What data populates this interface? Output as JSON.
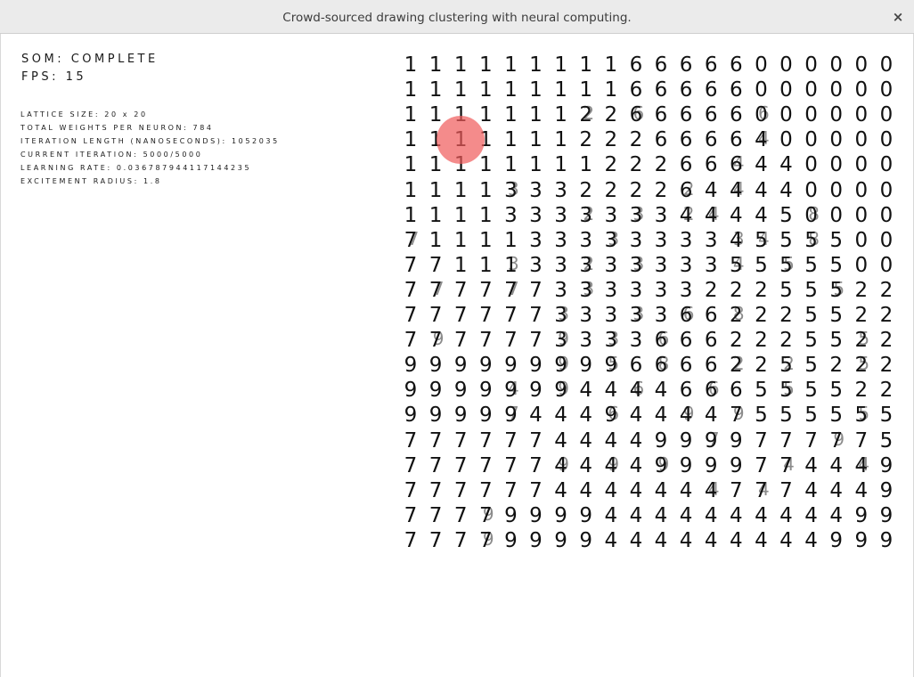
{
  "window": {
    "title": "Crowd-sourced drawing clustering with neural computing.",
    "close_symbol": "×"
  },
  "status": {
    "som": "SOM: COMPLETE",
    "fps": "FPS: 15"
  },
  "stats": [
    "LATTICE SIZE: 20 x 20",
    "TOTAL WEIGHTS PER NEURON: 784",
    "ITERATION LENGTH (NANOSECONDS): 1052035",
    "CURRENT ITERATION: 5000/5000",
    "LEARNING RATE: 0.036787944117144235",
    "EXCITEMENT RADIUS: 1.8"
  ],
  "lattice": {
    "rows": [
      "11111111166666000000",
      "11111111166666000000",
      "11111112266666000000",
      "11111112226666400000",
      "11111111222666440000",
      "11113332222644440000",
      "11113333333444450000",
      "71111333333334555500",
      "77111333333335555500",
      "77777733333322255522",
      "77777733333662225522",
      "77777733336662225522",
      "99999999966662255222",
      "99999994444666555522",
      "99999444944447555555",
      "77777744449999777775",
      "77777744449999774449",
      "77777744444447774449",
      "77779999444444444499",
      "77779999444444444999"
    ],
    "ghost_rows": [
      "                    ",
      "                    ",
      "       2 6    6      ",
      "              4      ",
      "             4       ",
      "    3      2 4       ",
      "       2 3 24   8    ",
      "7       3    34 8    ",
      "    3  2 3   4 5     ",
      " 7  7  3         5   ",
      "      3  3 6 8       ",
      " 9    9 3 6       5  ",
      "      9 5 8  2 2  5  ",
      "    4 9  6  6  5    5",
      "    7   6  9 9    5  ",
      "            7    9   ",
      "      9 9 9    4  4  ",
      "            4 4     ",
      "   9                ",
      "   9                "
    ],
    "bmu_row": 3,
    "bmu_col": 2,
    "bmu_color": "#f05a5a"
  }
}
